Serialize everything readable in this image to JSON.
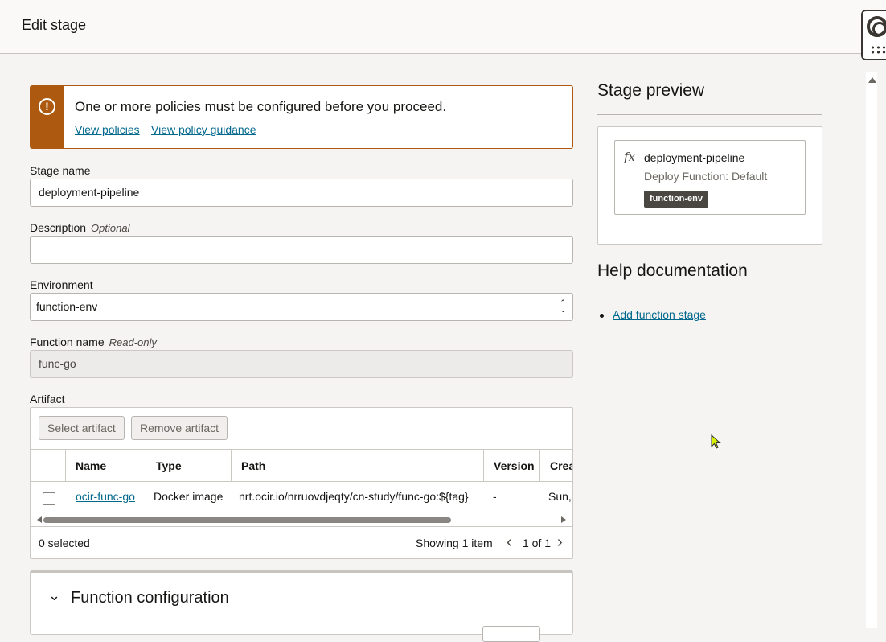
{
  "header": {
    "title": "Edit stage"
  },
  "alert": {
    "message": "One or more policies must be configured before you proceed.",
    "links": [
      "View policies",
      "View policy guidance"
    ],
    "color": "#ad5a10"
  },
  "form": {
    "stage_name": {
      "label": "Stage name",
      "value": "deployment-pipeline"
    },
    "description": {
      "label": "Description",
      "hint": "Optional",
      "value": ""
    },
    "environment": {
      "label": "Environment",
      "value": "function-env"
    },
    "function_name": {
      "label": "Function name",
      "hint": "Read-only",
      "value": "func-go"
    },
    "artifact": {
      "label": "Artifact"
    }
  },
  "artifact_table": {
    "select_label": "Select artifact",
    "remove_label": "Remove artifact",
    "columns": [
      "Name",
      "Type",
      "Path",
      "Version",
      "Crea"
    ],
    "rows": [
      {
        "name": "ocir-func-go",
        "type": "Docker image",
        "path": "nrt.ocir.io/nrruovdjeqty/cn-study/func-go:${tag}",
        "version": "-",
        "created": "Sun,"
      }
    ],
    "selected_text": "0 selected",
    "showing_text": "Showing 1 item",
    "pagination": "1 of 1"
  },
  "function_configuration": {
    "title": "Function configuration"
  },
  "stage_preview": {
    "title": "Stage preview",
    "icon_text": "fx",
    "stage_name": "deployment-pipeline",
    "stage_type": "Deploy Function: Default",
    "badge": "function-env"
  },
  "help": {
    "title": "Help documentation",
    "links": [
      "Add function stage"
    ]
  },
  "colors": {
    "link": "#00688c",
    "warning": "#ad5a10",
    "badge": "#4a4742"
  }
}
